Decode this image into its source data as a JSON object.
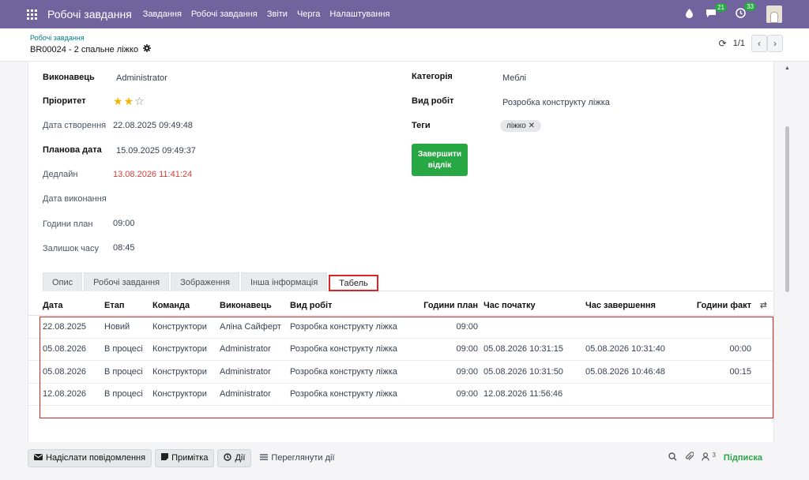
{
  "navbar": {
    "brand": "Робочі завдання",
    "menu": [
      "Завдання",
      "Робочі завдання",
      "Звіти",
      "Черга",
      "Налаштування"
    ],
    "messages_count": "21",
    "activities_count": "33"
  },
  "control": {
    "breadcrumb": "Робочі завдання",
    "record_title": "BR00024 - 2 спальне ліжко",
    "pager": "1/1"
  },
  "form": {
    "executor_label": "Виконавець",
    "executor": "Administrator",
    "priority_label": "Пріоритет",
    "priority_stars": 2,
    "priority_max": 3,
    "created_label": "Дата створення",
    "created": "22.08.2025 09:49:48",
    "planned_label": "Планова дата",
    "planned": "15.09.2025 09:49:37",
    "deadline_label": "Дедлайн",
    "deadline": "13.08.2026 11:41:24",
    "done_label": "Дата виконання",
    "hours_plan_label": "Години план",
    "hours_plan": "09:00",
    "remaining_label": "Залишок часу",
    "remaining": "08:45",
    "category_label": "Категорія",
    "category": "Меблі",
    "worktype_label": "Вид робіт",
    "worktype": "Розробка конструкту ліжка",
    "tags_label": "Теги",
    "tag": "ліжко",
    "finish_button": "Завершити відлік"
  },
  "tabs": [
    "Опис",
    "Робочі завдання",
    "Зображення",
    "Інша інформація",
    "Табель"
  ],
  "grid": {
    "headers": [
      "Дата",
      "Етап",
      "Команда",
      "Виконавець",
      "Вид робіт",
      "Години план",
      "Час початку",
      "Час завершення",
      "Години факт"
    ],
    "rows": [
      [
        "22.08.2025",
        "Новий",
        "Конструктори",
        "Аліна Сайферт",
        "Розробка конструкту ліжка",
        "09:00",
        "",
        "",
        ""
      ],
      [
        "05.08.2026",
        "В процесі",
        "Конструктори",
        "Administrator",
        "Розробка конструкту ліжка",
        "09:00",
        "05.08.2026 10:31:15",
        "05.08.2026 10:31:40",
        "00:00"
      ],
      [
        "05.08.2026",
        "В процесі",
        "Конструктори",
        "Administrator",
        "Розробка конструкту ліжка",
        "09:00",
        "05.08.2026 10:31:50",
        "05.08.2026 10:46:48",
        "00:15"
      ],
      [
        "12.08.2026",
        "В процесі",
        "Конструктори",
        "Administrator",
        "Розробка конструкту ліжка",
        "09:00",
        "12.08.2026 11:56:46",
        "",
        ""
      ]
    ]
  },
  "chatter": {
    "send_message": "Надіслати повідомлення",
    "note": "Примітка",
    "activities": "Дії",
    "view_activities": "Переглянути дії",
    "followers_count": "3",
    "follow": "Підписка"
  }
}
